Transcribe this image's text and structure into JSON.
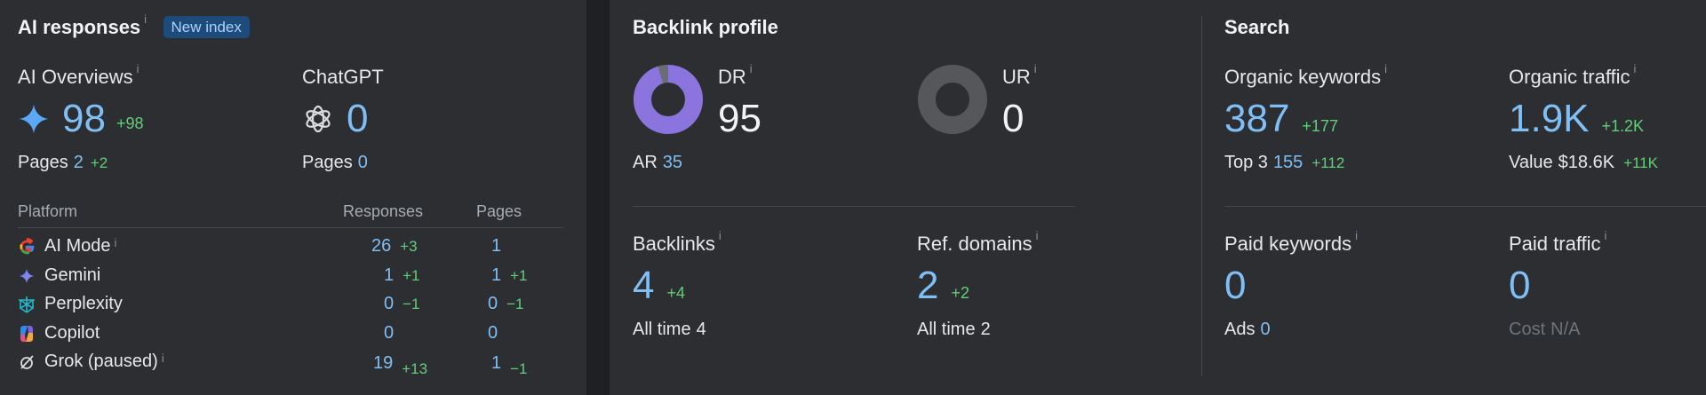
{
  "ai": {
    "title": "AI responses",
    "badge": "New index",
    "overviews": {
      "label": "AI Overviews",
      "value": "98",
      "delta": "+98",
      "pages_label": "Pages",
      "pages_value": "2",
      "pages_delta": "+2"
    },
    "chatgpt": {
      "label": "ChatGPT",
      "value": "0",
      "pages_label": "Pages",
      "pages_value": "0"
    },
    "table": {
      "headers": {
        "platform": "Platform",
        "responses": "Responses",
        "pages": "Pages"
      },
      "rows": [
        {
          "name": "AI Mode",
          "responses": "26",
          "resp_delta": "+3",
          "pages": "1",
          "pages_delta": ""
        },
        {
          "name": "Gemini",
          "responses": "1",
          "resp_delta": "+1",
          "pages": "1",
          "pages_delta": "+1"
        },
        {
          "name": "Perplexity",
          "responses": "0",
          "resp_delta": "−1",
          "pages": "0",
          "pages_delta": "−1"
        },
        {
          "name": "Copilot",
          "responses": "0",
          "resp_delta": "",
          "pages": "0",
          "pages_delta": ""
        },
        {
          "name": "Grok (paused)",
          "responses": "19",
          "resp_delta": "+13",
          "pages": "1",
          "pages_delta": "−1"
        }
      ]
    }
  },
  "backlink": {
    "title": "Backlink profile",
    "dr": {
      "label": "DR",
      "value": "95",
      "fill_percent": 95,
      "color": "#8b74de"
    },
    "ur": {
      "label": "UR",
      "value": "0",
      "fill_percent": 0
    },
    "ar": {
      "label": "AR",
      "value": "35"
    },
    "backlinks": {
      "label": "Backlinks",
      "value": "4",
      "delta": "+4",
      "sub_label": "All time",
      "sub_value": "4"
    },
    "refdomains": {
      "label": "Ref. domains",
      "value": "2",
      "delta": "+2",
      "sub_label": "All time",
      "sub_value": "2"
    }
  },
  "search": {
    "title": "Search",
    "organic_keywords": {
      "label": "Organic keywords",
      "value": "387",
      "delta": "+177",
      "sub_label": "Top 3",
      "sub_value": "155",
      "sub_delta": "+112"
    },
    "organic_traffic": {
      "label": "Organic traffic",
      "value": "1.9K",
      "delta": "+1.2K",
      "sub_label": "Value",
      "sub_value": "$18.6K",
      "sub_delta": "+11K"
    },
    "paid_keywords": {
      "label": "Paid keywords",
      "value": "0",
      "sub_label": "Ads",
      "sub_value": "0"
    },
    "paid_traffic": {
      "label": "Paid traffic",
      "value": "0",
      "sub_label": "Cost",
      "sub_value": "N/A"
    }
  },
  "info_glyph": "i"
}
